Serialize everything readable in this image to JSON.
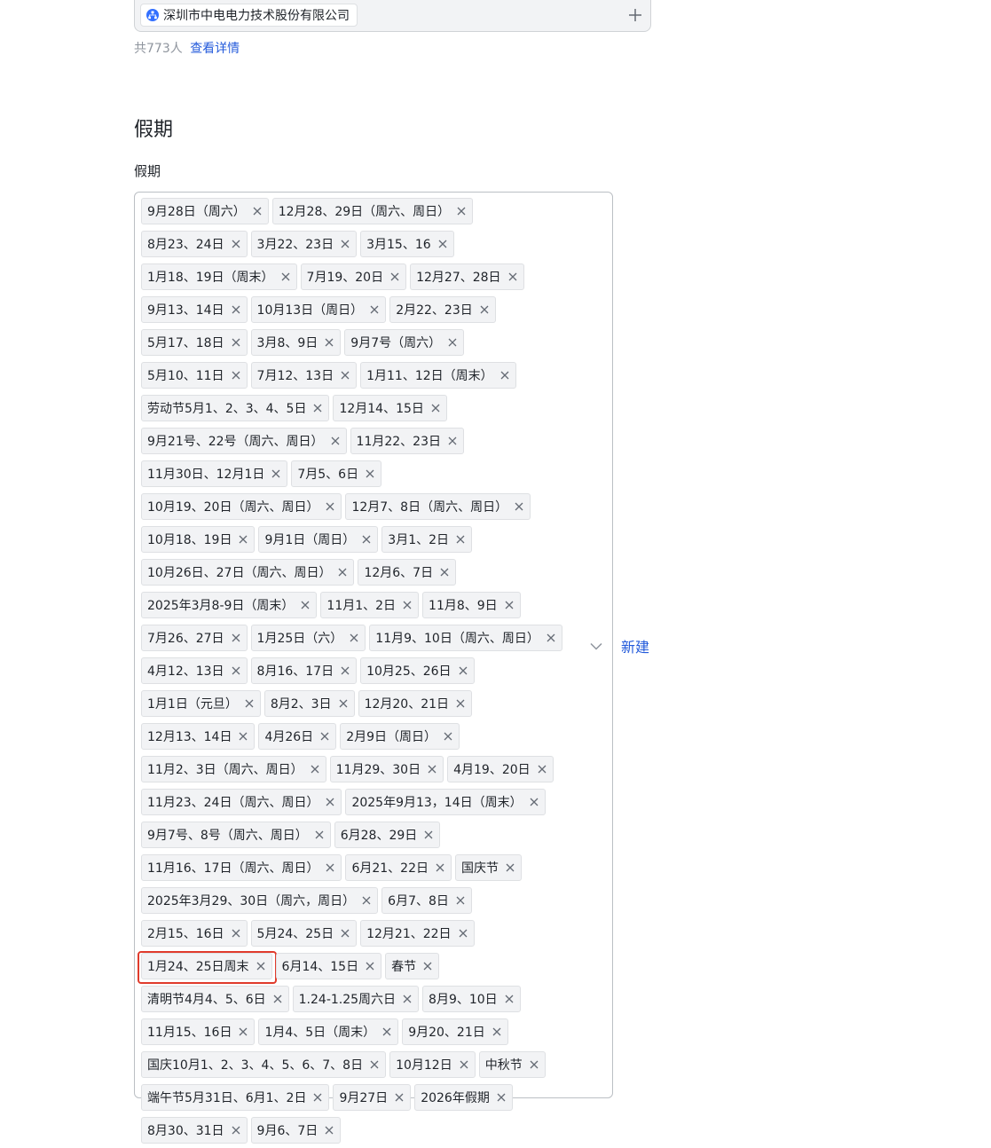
{
  "org": {
    "name": "深圳市中电电力技术股份有限公司",
    "icon": "org-icon"
  },
  "member_count": "共773人",
  "detail_link": "查看详情",
  "section_title": "假期",
  "field_label": "假期",
  "new_label": "新建",
  "highlight_color": "#e03b2c",
  "link_color": "#245bdb",
  "tags": [
    "9月28日（周六）",
    "12月28、29日（周六、周日）",
    "8月23、24日",
    "3月22、23日",
    "3月15、16",
    "1月18、19日（周末）",
    "7月19、20日",
    "12月27、28日",
    "9月13、14日",
    "10月13日（周日）",
    "2月22、23日",
    "5月17、18日",
    "3月8、9日",
    "9月7号（周六）",
    "5月10、11日",
    "7月12、13日",
    "1月11、12日（周末）",
    "劳动节5月1、2、3、4、5日",
    "12月14、15日",
    "9月21号、22号（周六、周日）",
    "11月22、23日",
    "11月30日、12月1日",
    "7月5、6日",
    "10月19、20日（周六、周日）",
    "12月7、8日（周六、周日）",
    "10月18、19日",
    "9月1日（周日）",
    "3月1、2日",
    "10月26日、27日（周六、周日）",
    "12月6、7日",
    "2025年3月8-9日（周末）",
    "11月1、2日",
    "11月8、9日",
    "7月26、27日",
    "1月25日（六）",
    "11月9、10日（周六、周日）",
    "4月12、13日",
    "8月16、17日",
    "10月25、26日",
    "1月1日（元旦）",
    "8月2、3日",
    "12月20、21日",
    "12月13、14日",
    "4月26日",
    "2月9日（周日）",
    "11月2、3日（周六、周日）",
    "11月29、30日",
    "4月19、20日",
    "11月23、24日（周六、周日）",
    "2025年9月13，14日（周末）",
    "9月7号、8号（周六、周日）",
    "6月28、29日",
    "11月16、17日（周六、周日）",
    "6月21、22日",
    "国庆节",
    "2025年3月29、30日（周六，周日）",
    "6月7、8日",
    "2月15、16日",
    "5月24、25日",
    "12月21、22日",
    "1月24、25日周末",
    "6月14、15日",
    "春节",
    "清明节4月4、5、6日",
    "1.24-1.25周六日",
    "8月9、10日",
    "11月15、16日",
    "1月4、5日（周末）",
    "9月20、21日",
    "国庆10月1、2、3、4、5、6、7、8日",
    "10月12日",
    "中秋节",
    "端午节5月31日、6月1、2日",
    "9月27日",
    "2026年假期",
    "8月30、31日",
    "9月6、7日"
  ],
  "highlighted_tag": "1月24、25日周末"
}
